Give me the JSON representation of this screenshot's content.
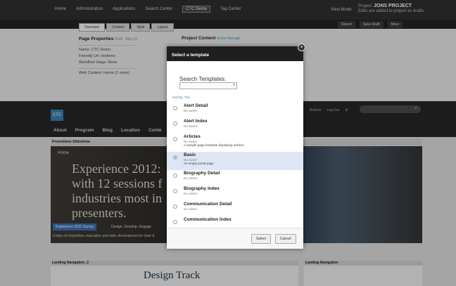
{
  "topbar": {
    "nav": [
      "Home",
      "Administration",
      "Applications",
      "Search Center",
      "CTC Demo",
      "Tag Center"
    ],
    "active_index": 4,
    "view_mode": "View Mode",
    "project_prefix": "Project:",
    "project_name": "JONS PROJECT",
    "project_note": "Edits are added to project as drafts"
  },
  "subbar": {
    "buttons": [
      "Revert",
      "Save Draft",
      "More"
    ]
  },
  "props": {
    "tabs": [
      "Overview",
      "Content",
      "Style",
      "Layout"
    ],
    "title": "Page Properties",
    "title_meta": "Draft · May 16",
    "name": "Name: CTC Demo",
    "url": "Friendly Url: ctcdemo",
    "workflow": "Workflow Stage: None",
    "web_content": "Web Content: Home (1 more)",
    "content_title": "Project Content",
    "content_meta": "Active Manage"
  },
  "site": {
    "logo": "CTC",
    "nav": [
      "About",
      "Program",
      "Blog",
      "Location",
      "Conte"
    ],
    "actions": [
      "Actions",
      "Log Out"
    ]
  },
  "slideshow": {
    "header": "Promotions Slideshow",
    "home": "Home",
    "lines": [
      "Experience 2012:",
      "with 12 sessions f",
      "industries most in",
      "presenters."
    ],
    "pill": "Experience 2012 Survey",
    "tags": "Design. Develop. Engage.",
    "caption": "3 days of inspiration, education and skills development for User E"
  },
  "bottom": {
    "left_header": "Landing Navigation_2",
    "left_title": "Design Track",
    "right_header": "Landing Navigation"
  },
  "modal": {
    "title": "Select a template",
    "close": "×",
    "search_label": "Search Templates:",
    "sort_label": "Sort by:",
    "sort_value": "Title",
    "items": [
      {
        "title": "Alert Detail",
        "owner": "No owner",
        "desc": ""
      },
      {
        "title": "Alert Index",
        "owner": "No owner",
        "desc": ""
      },
      {
        "title": "Articles",
        "owner": "No owner",
        "desc": "A sample page template displaying articles."
      },
      {
        "title": "Basic",
        "owner": "No owner",
        "desc": "An empty portal page"
      },
      {
        "title": "Biography Detail",
        "owner": "No owner",
        "desc": ""
      },
      {
        "title": "Biography Index",
        "owner": "No owner",
        "desc": ""
      },
      {
        "title": "Communication Detail",
        "owner": "No owner",
        "desc": ""
      },
      {
        "title": "Communication Index",
        "owner": "",
        "desc": ""
      }
    ],
    "selected_index": 3,
    "select_btn": "Select",
    "cancel_btn": "Cancel"
  }
}
